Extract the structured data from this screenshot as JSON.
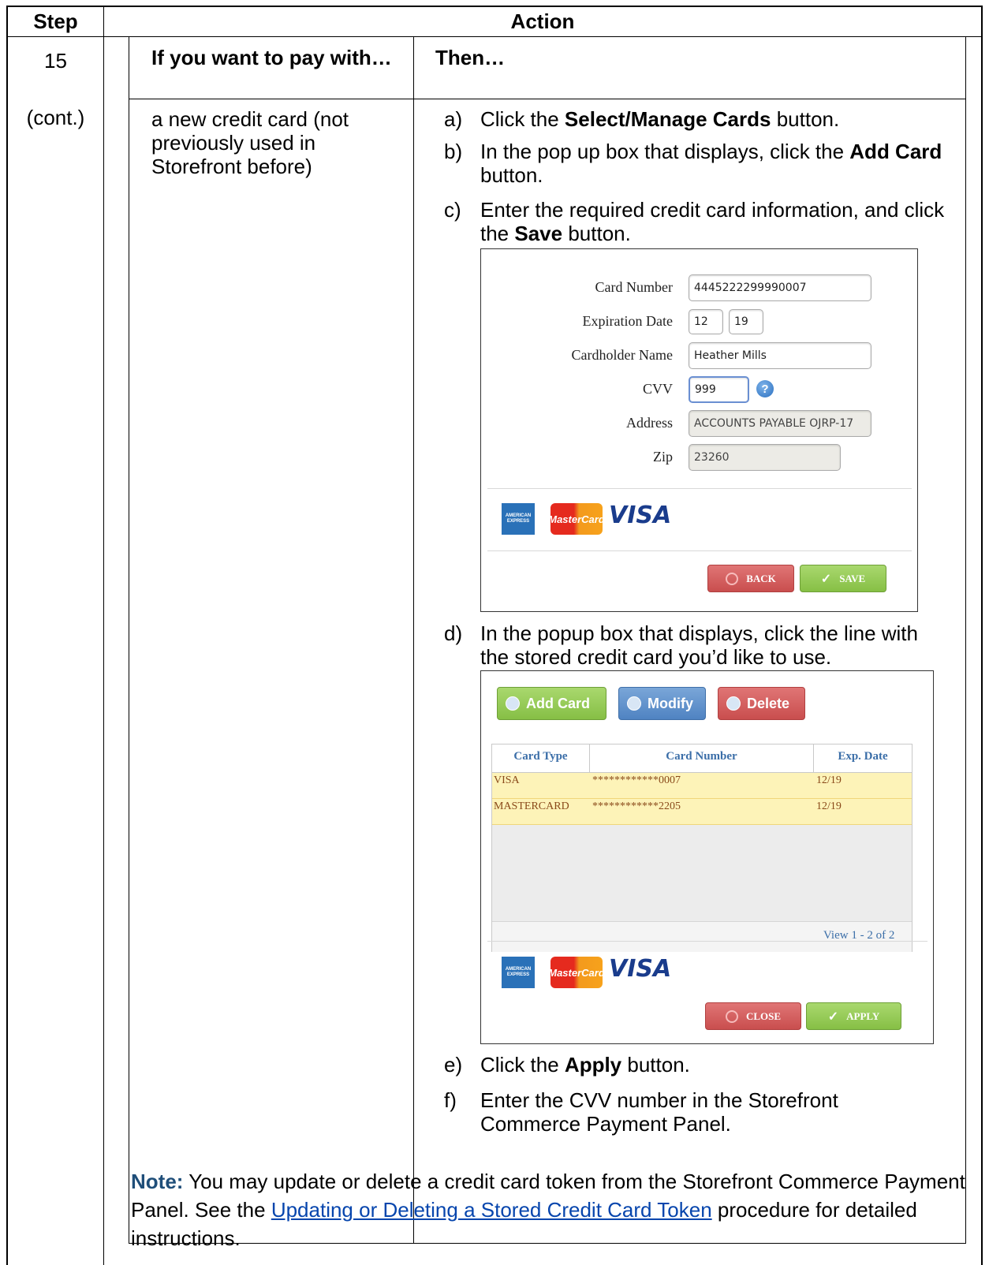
{
  "table": {
    "header_step": "Step",
    "header_action": "Action",
    "step_number": "15",
    "step_cont": "(cont.)",
    "col_if": "If you want to pay with…",
    "col_then": "Then…",
    "condition": "a new credit card (not previously used in Storefront before)"
  },
  "steps": {
    "a_letter": "a)",
    "a_pre": "Click the ",
    "a_bold": "Select/Manage Cards",
    "a_post": " button.",
    "b_letter": "b)",
    "b_pre": "In the pop up box that displays, click the ",
    "b_bold": "Add Card",
    "b_post": " button.",
    "c_letter": "c)",
    "c_pre": "Enter the required credit card information, and click the ",
    "c_bold": "Save",
    "c_post": " button.",
    "d_letter": "d)",
    "d_text": "In the popup box that displays, click the line with the stored credit card you’d like to use.",
    "e_letter": "e)",
    "e_pre": "Click the ",
    "e_bold": "Apply",
    "e_post": " button.",
    "f_letter": "f)",
    "f_text": "Enter the CVV number in the Storefront Commerce Payment Panel."
  },
  "card_form": {
    "card_number_label": "Card Number",
    "card_number_value": "4445222299990007",
    "expiration_label": "Expiration Date",
    "exp_month": "12",
    "exp_year": "19",
    "cardholder_label": "Cardholder Name",
    "cardholder_value": "Heather Mills",
    "cvv_label": "CVV",
    "cvv_value": "999",
    "address_label": "Address",
    "address_value": "ACCOUNTS PAYABLE OJRP-17",
    "zip_label": "Zip",
    "zip_value": "23260",
    "back_label": "BACK",
    "save_label": "SAVE",
    "help_icon": "question-icon"
  },
  "card_list": {
    "add_label": "Add Card",
    "modify_label": "Modify",
    "delete_label": "Delete",
    "columns": [
      "Card Type",
      "Card Number",
      "Exp. Date"
    ],
    "rows": [
      {
        "type": "VISA",
        "number": "************0007",
        "exp": "12/19"
      },
      {
        "type": "MASTERCARD",
        "number": "************2205",
        "exp": "12/19"
      }
    ],
    "pager": "View 1 - 2 of 2",
    "close_label": "CLOSE",
    "apply_label": "APPLY"
  },
  "logos": {
    "amex_line1": "AMERICAN",
    "amex_line2": "EXPRESS",
    "mastercard": "MasterCard",
    "visa": "VISA"
  },
  "note": {
    "label": "Note:",
    "text1": "  You may update or delete a credit card token from the Storefront Commerce Payment Panel. See the ",
    "link": "Updating or Deleting a Stored Credit Card Token",
    "text2": " procedure for detailed instructions."
  },
  "colors": {
    "note_label": "#1f4e79",
    "link": "#0645ad",
    "row_highlight": "#fdf3b8"
  }
}
